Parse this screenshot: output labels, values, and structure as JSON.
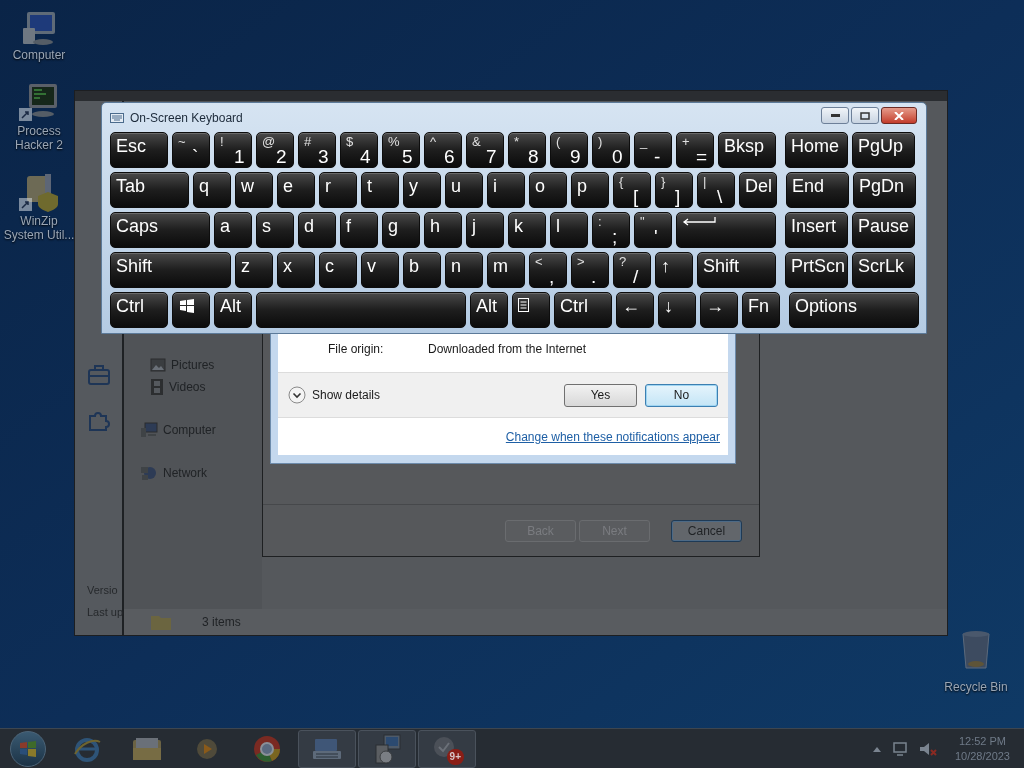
{
  "desktop_icons": [
    {
      "kind": "computer",
      "label": "Computer"
    },
    {
      "kind": "shortcut",
      "label": "Process Hacker 2"
    },
    {
      "kind": "archive",
      "label": "WinZip System Util..."
    }
  ],
  "recycle_bin": {
    "label": "Recycle Bin"
  },
  "explorer": {
    "nav": [
      {
        "kind": "pictures",
        "label": "Pictures"
      },
      {
        "kind": "videos",
        "label": "Videos"
      },
      {
        "kind": "computer",
        "label": "Computer"
      },
      {
        "kind": "network",
        "label": "Network"
      }
    ],
    "side_texts": [
      "Versio",
      "Last up"
    ],
    "status": "3 items"
  },
  "wizard": {
    "buttons": [
      {
        "label": "Back",
        "disabled": true
      },
      {
        "label": "Next",
        "disabled": true
      },
      {
        "label": "Cancel",
        "disabled": false
      }
    ]
  },
  "uac": {
    "field_label": "File origin:",
    "field_value": "Downloaded from the Internet",
    "details": "Show details",
    "buttons": [
      {
        "label": "Yes",
        "selected": false
      },
      {
        "label": "No",
        "selected": true
      }
    ],
    "link": "Change when these notifications appear"
  },
  "keyboard": {
    "title": "On-Screen Keyboard",
    "rows": [
      {
        "main": [
          {
            "kind": "char",
            "label": "Esc"
          },
          {
            "kind": "char",
            "shift": "~",
            "label": "`"
          },
          {
            "kind": "char",
            "shift": "!",
            "label": "1"
          },
          {
            "kind": "char",
            "shift": "@",
            "label": "2"
          },
          {
            "kind": "char",
            "shift": "#",
            "label": "3"
          },
          {
            "kind": "char",
            "shift": "$",
            "label": "4"
          },
          {
            "kind": "char",
            "shift": "%",
            "label": "5"
          },
          {
            "kind": "char",
            "shift": "^",
            "label": "6"
          },
          {
            "kind": "char",
            "shift": "&",
            "label": "7"
          },
          {
            "kind": "char",
            "shift": "*",
            "label": "8"
          },
          {
            "kind": "char",
            "shift": "(",
            "label": "9"
          },
          {
            "kind": "char",
            "shift": ")",
            "label": "0"
          },
          {
            "kind": "char",
            "shift": "_",
            "label": "-"
          },
          {
            "kind": "char",
            "shift": "+",
            "label": "="
          },
          {
            "kind": "char",
            "label": "Bksp"
          }
        ],
        "nav": [
          {
            "label": "Home"
          },
          {
            "label": "PgUp"
          }
        ]
      },
      {
        "main": [
          {
            "kind": "char",
            "label": "Tab"
          },
          {
            "kind": "char",
            "label": "q"
          },
          {
            "kind": "char",
            "label": "w"
          },
          {
            "kind": "char",
            "label": "e"
          },
          {
            "kind": "char",
            "label": "r"
          },
          {
            "kind": "char",
            "label": "t"
          },
          {
            "kind": "char",
            "label": "y"
          },
          {
            "kind": "char",
            "label": "u"
          },
          {
            "kind": "char",
            "label": "i"
          },
          {
            "kind": "char",
            "label": "o"
          },
          {
            "kind": "char",
            "label": "p"
          },
          {
            "kind": "char",
            "shift": "{",
            "label": "["
          },
          {
            "kind": "char",
            "shift": "}",
            "label": "]"
          },
          {
            "kind": "char",
            "shift": "|",
            "label": "\\"
          },
          {
            "kind": "char",
            "label": "Del"
          }
        ],
        "nav": [
          {
            "label": "End"
          },
          {
            "label": "PgDn"
          }
        ]
      },
      {
        "main": [
          {
            "kind": "char",
            "label": "Caps"
          },
          {
            "kind": "char",
            "label": "a"
          },
          {
            "kind": "char",
            "label": "s"
          },
          {
            "kind": "char",
            "label": "d"
          },
          {
            "kind": "char",
            "label": "f"
          },
          {
            "kind": "char",
            "label": "g"
          },
          {
            "kind": "char",
            "label": "h"
          },
          {
            "kind": "char",
            "label": "j"
          },
          {
            "kind": "char",
            "label": "k"
          },
          {
            "kind": "char",
            "label": "l"
          },
          {
            "kind": "char",
            "shift": ":",
            "label": ";"
          },
          {
            "kind": "char",
            "shift": "\"",
            "label": "'"
          },
          {
            "kind": "enter"
          }
        ],
        "nav": [
          {
            "label": "Insert"
          },
          {
            "label": "Pause"
          }
        ]
      },
      {
        "main": [
          {
            "kind": "char",
            "label": "Shift"
          },
          {
            "kind": "char",
            "label": "z"
          },
          {
            "kind": "char",
            "label": "x"
          },
          {
            "kind": "char",
            "label": "c"
          },
          {
            "kind": "char",
            "label": "v"
          },
          {
            "kind": "char",
            "label": "b"
          },
          {
            "kind": "char",
            "label": "n"
          },
          {
            "kind": "char",
            "label": "m"
          },
          {
            "kind": "char",
            "shift": "<",
            "label": ","
          },
          {
            "kind": "char",
            "shift": ">",
            "label": "."
          },
          {
            "kind": "char",
            "shift": "?",
            "label": "/"
          },
          {
            "kind": "char",
            "label": "↑"
          },
          {
            "kind": "char",
            "label": "Shift"
          }
        ],
        "nav": [
          {
            "label": "PrtScn"
          },
          {
            "label": "ScrLk"
          }
        ]
      },
      {
        "main": [
          {
            "kind": "char",
            "label": "Ctrl"
          },
          {
            "kind": "windows"
          },
          {
            "kind": "char",
            "label": "Alt"
          },
          {
            "kind": "space"
          },
          {
            "kind": "char",
            "label": "Alt"
          },
          {
            "kind": "menu"
          },
          {
            "kind": "char",
            "label": "Ctrl"
          },
          {
            "kind": "char",
            "label": "←"
          },
          {
            "kind": "char",
            "label": "↓"
          },
          {
            "kind": "char",
            "label": "→"
          },
          {
            "kind": "char",
            "label": "Fn"
          }
        ],
        "nav": [
          {
            "label": "Options"
          }
        ]
      }
    ]
  },
  "taskbar": {
    "items": [
      {
        "kind": "browser",
        "open": false
      },
      {
        "kind": "folder",
        "open": false
      },
      {
        "kind": "media",
        "open": false
      },
      {
        "kind": "chrome",
        "open": false
      },
      {
        "kind": "keyboard",
        "open": true
      },
      {
        "kind": "installer",
        "open": true
      },
      {
        "kind": "app",
        "open": true,
        "badge": "9+"
      }
    ],
    "time": "12:52 PM",
    "date": "10/28/2023"
  }
}
